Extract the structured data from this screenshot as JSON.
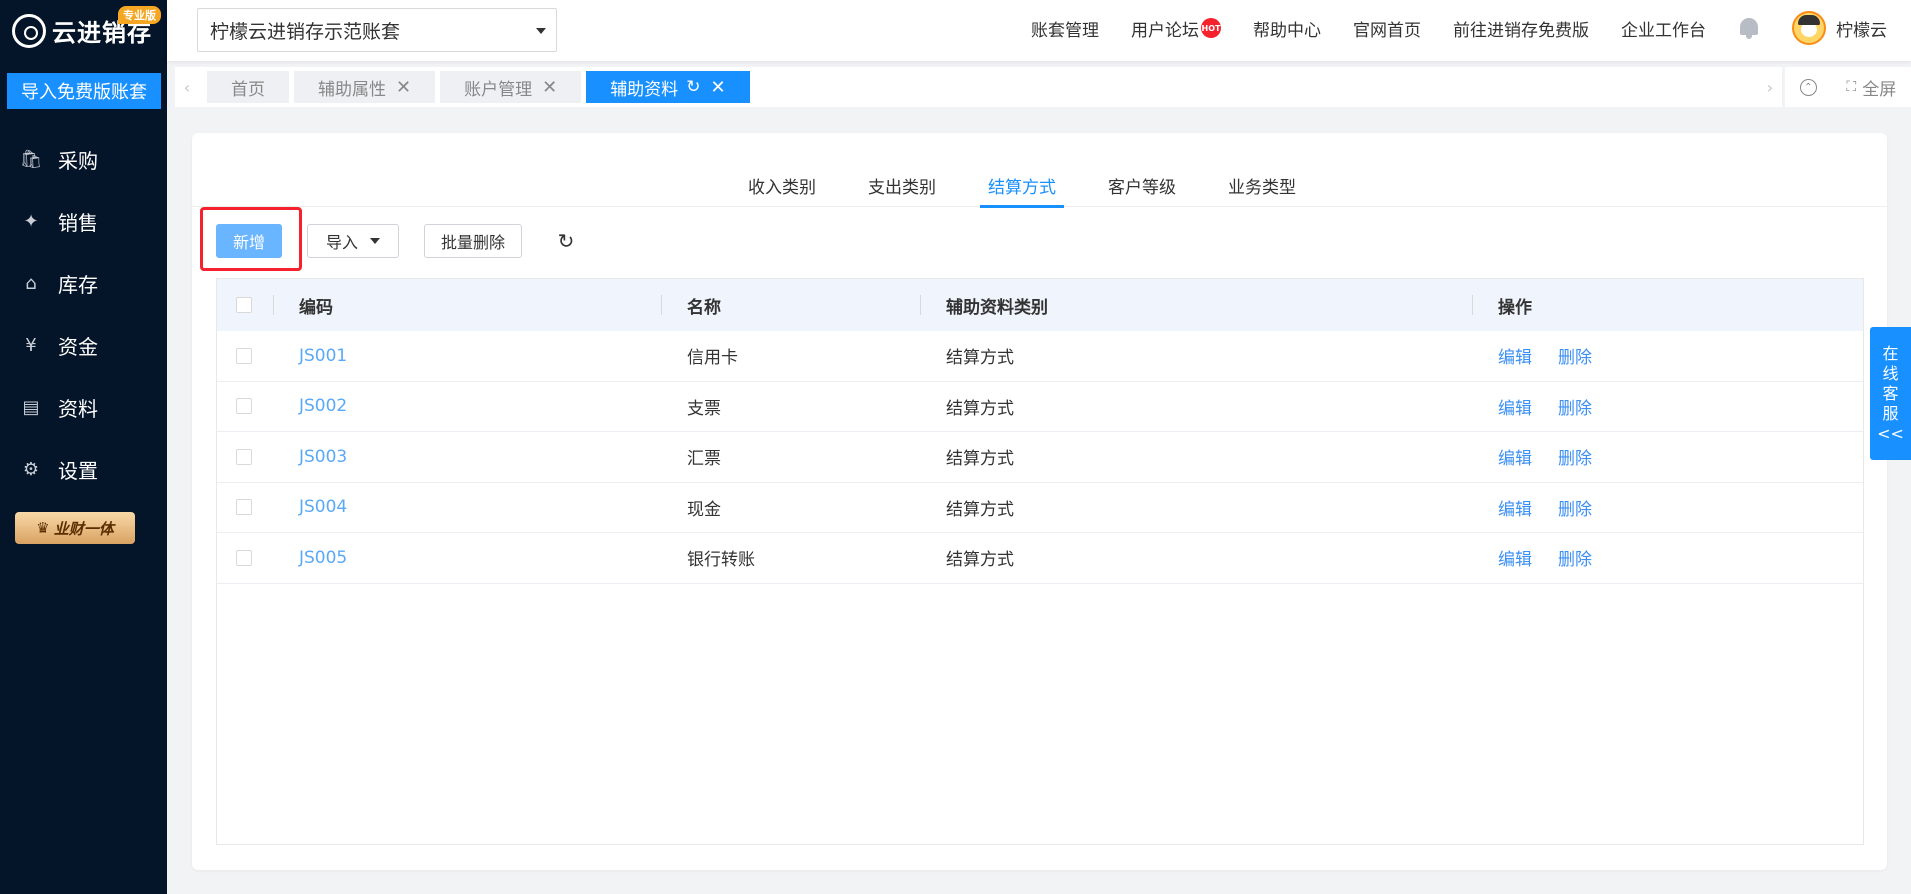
{
  "sidebar": {
    "logo_text": "云进销存",
    "badge": "专业版",
    "import_button": "导入免费版账套",
    "items": [
      {
        "label": "采购",
        "icon": "🛍"
      },
      {
        "label": "销售",
        "icon": "✦"
      },
      {
        "label": "库存",
        "icon": "⌂"
      },
      {
        "label": "资金",
        "icon": "¥"
      },
      {
        "label": "资料",
        "icon": "▤"
      },
      {
        "label": "设置",
        "icon": "⚙"
      }
    ],
    "promo": "业财一体"
  },
  "header": {
    "account": "柠檬云进销存示范账套",
    "links": [
      "账套管理",
      "用户论坛",
      "帮助中心",
      "官网首页",
      "前往进销存免费版",
      "企业工作台"
    ],
    "hot_badge": "HOT",
    "username": "柠檬云"
  },
  "tabs": [
    {
      "label": "首页"
    },
    {
      "label": "辅助属性"
    },
    {
      "label": "账户管理"
    },
    {
      "label": "辅助资料"
    }
  ],
  "tools": {
    "fullscreen": "全屏"
  },
  "subtabs": [
    "收入类别",
    "支出类别",
    "结算方式",
    "客户等级",
    "业务类型"
  ],
  "toolbar": {
    "add": "新增",
    "import": "导入",
    "batch_delete": "批量删除"
  },
  "table": {
    "headers": {
      "code": "编码",
      "name": "名称",
      "type": "辅助资料类别",
      "ops": "操作"
    },
    "ops": {
      "edit": "编辑",
      "delete": "删除"
    },
    "rows": [
      {
        "code": "JS001",
        "name": "信用卡",
        "type": "结算方式"
      },
      {
        "code": "JS002",
        "name": "支票",
        "type": "结算方式"
      },
      {
        "code": "JS003",
        "name": "汇票",
        "type": "结算方式"
      },
      {
        "code": "JS004",
        "name": "现金",
        "type": "结算方式"
      },
      {
        "code": "JS005",
        "name": "银行转账",
        "type": "结算方式"
      }
    ]
  },
  "service": {
    "chars": [
      "在",
      "线",
      "客",
      "服",
      "<<"
    ]
  },
  "colors": {
    "primary": "#1890ff",
    "sidebar": "#041429",
    "highlight": "#f5222d"
  }
}
